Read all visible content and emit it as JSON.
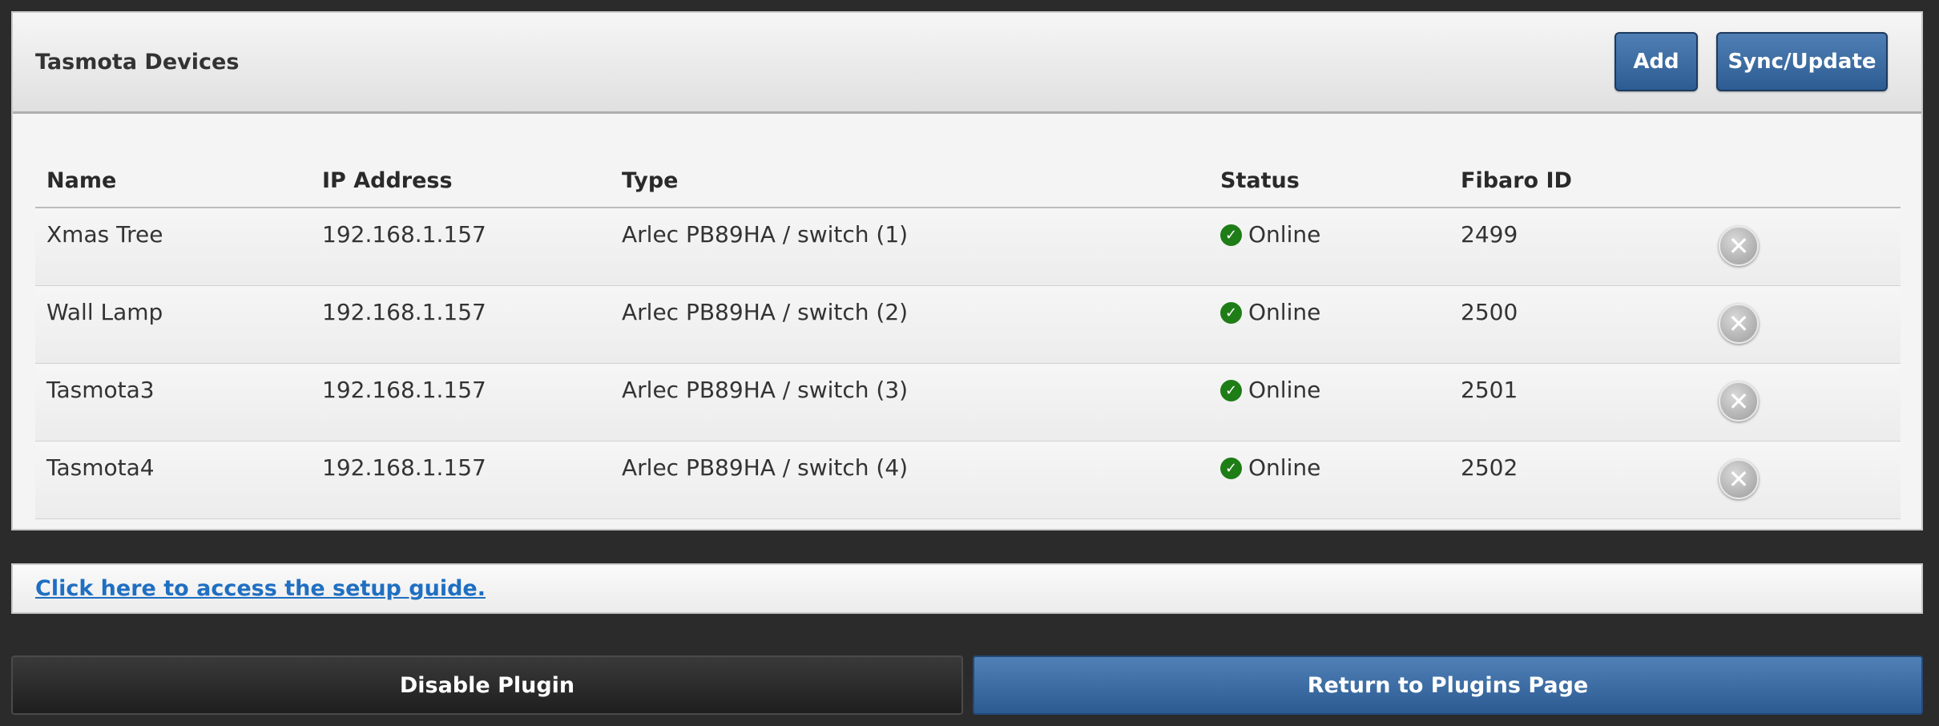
{
  "panel": {
    "title": "Tasmota Devices",
    "add_label": "Add",
    "sync_label": "Sync/Update"
  },
  "table": {
    "headers": [
      "Name",
      "IP Address",
      "Type",
      "Status",
      "Fibaro ID"
    ],
    "rows": [
      {
        "name": "Xmas Tree",
        "ip": "192.168.1.157",
        "type": "Arlec PB89HA / switch (1)",
        "status": "Online",
        "fibaro_id": "2499"
      },
      {
        "name": "Wall Lamp",
        "ip": "192.168.1.157",
        "type": "Arlec PB89HA / switch (2)",
        "status": "Online",
        "fibaro_id": "2500"
      },
      {
        "name": "Tasmota3",
        "ip": "192.168.1.157",
        "type": "Arlec PB89HA / switch (3)",
        "status": "Online",
        "fibaro_id": "2501"
      },
      {
        "name": "Tasmota4",
        "ip": "192.168.1.157",
        "type": "Arlec PB89HA / switch (4)",
        "status": "Online",
        "fibaro_id": "2502"
      }
    ]
  },
  "guide": {
    "link_text": "Click here to access the setup guide."
  },
  "footer": {
    "disable_label": "Disable Plugin",
    "return_label": "Return to Plugins Page"
  },
  "icons": {
    "status_ok": "check-circle-icon",
    "delete": "close-circle-icon"
  },
  "colors": {
    "accent_blue": "#2d5c92",
    "online_green": "#1e7d16",
    "link_blue": "#1f6fc2"
  }
}
